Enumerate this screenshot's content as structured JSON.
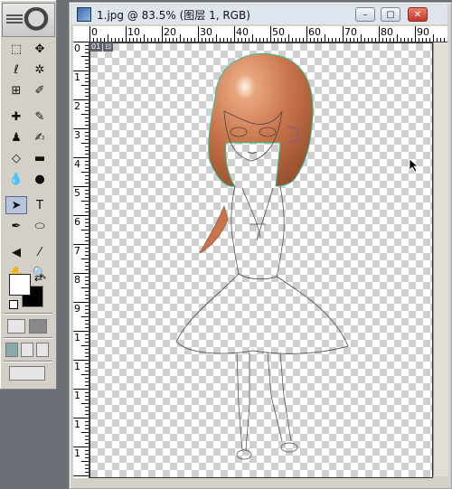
{
  "window": {
    "title": "1.jpg @ 83.5% (图层 1, RGB)",
    "minimize_glyph": "–",
    "maximize_glyph": "▢",
    "close_glyph": "✕"
  },
  "rulers": {
    "top_labels": [
      "0",
      "10",
      "20",
      "30",
      "40",
      "50",
      "60",
      "70",
      "80",
      "90",
      "100"
    ],
    "left_labels": [
      "0",
      "1",
      "2",
      "3",
      "4",
      "5",
      "6",
      "7",
      "8",
      "9",
      "1",
      "1",
      "1",
      "1",
      "1",
      "1"
    ]
  },
  "layer_badge": [
    "01",
    "⊡"
  ],
  "toolbox": {
    "tools": [
      {
        "name": "marquee-tool",
        "glyph": "⬚"
      },
      {
        "name": "move-tool",
        "glyph": "✥"
      },
      {
        "name": "lasso-tool",
        "glyph": "ℓ"
      },
      {
        "name": "magic-wand-tool",
        "glyph": "✲"
      },
      {
        "name": "crop-tool",
        "glyph": "⊞"
      },
      {
        "name": "slice-tool",
        "glyph": "✐"
      },
      {
        "name": "healing-brush-tool",
        "glyph": "✚"
      },
      {
        "name": "brush-tool",
        "glyph": "✎"
      },
      {
        "name": "clone-stamp-tool",
        "glyph": "♟"
      },
      {
        "name": "history-brush-tool",
        "glyph": "✍"
      },
      {
        "name": "eraser-tool",
        "glyph": "◇"
      },
      {
        "name": "gradient-tool",
        "glyph": "▬"
      },
      {
        "name": "blur-tool",
        "glyph": "💧"
      },
      {
        "name": "dodge-tool",
        "glyph": "●"
      },
      {
        "name": "path-selection-tool",
        "glyph": "➤"
      },
      {
        "name": "type-tool",
        "glyph": "T"
      },
      {
        "name": "pen-tool",
        "glyph": "✒"
      },
      {
        "name": "shape-tool",
        "glyph": "⬭"
      },
      {
        "name": "notes-tool",
        "glyph": "◀"
      },
      {
        "name": "eyedropper-tool",
        "glyph": "⁄"
      },
      {
        "name": "hand-tool",
        "glyph": "✋"
      },
      {
        "name": "zoom-tool",
        "glyph": "🔍"
      }
    ]
  },
  "colors": {
    "hair": "#c8734a",
    "hair_shade": "#a55a35",
    "line": "#444444",
    "outline_highlight": "#3fd0a0"
  }
}
